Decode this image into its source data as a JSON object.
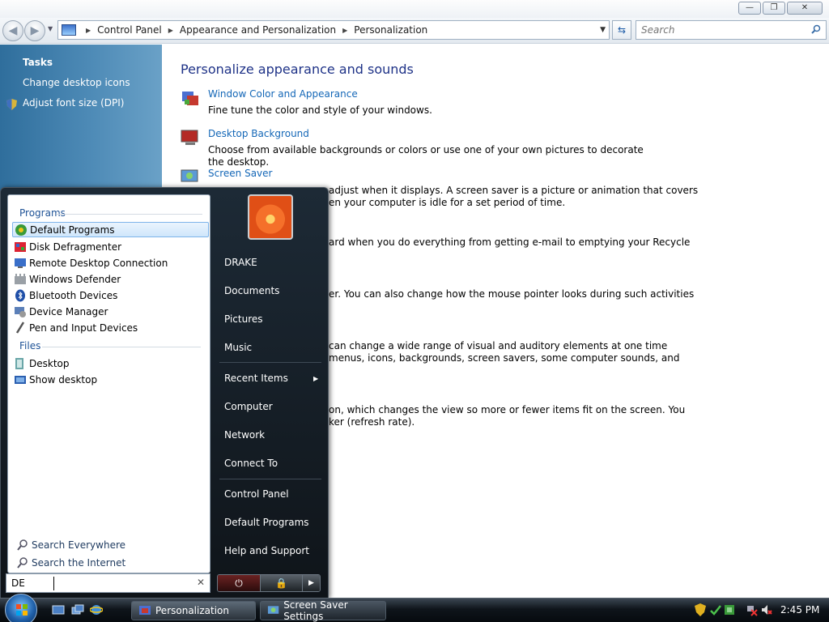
{
  "window": {
    "title_buttons": {
      "minimize": "—",
      "maximize": "❐",
      "close": "✕"
    }
  },
  "address": {
    "crumbs": [
      "Control Panel",
      "Appearance and Personalization",
      "Personalization"
    ],
    "search_placeholder": "Search"
  },
  "tasks": {
    "title": "Tasks",
    "links": [
      "Change desktop icons",
      "Adjust font size (DPI)"
    ]
  },
  "main": {
    "heading": "Personalize appearance and sounds",
    "items": [
      {
        "title": "Window Color and Appearance",
        "desc": "Fine tune the color and style of your windows."
      },
      {
        "title": "Desktop Background",
        "desc": "Choose from available backgrounds or colors or use one of your own pictures to decorate the desktop."
      },
      {
        "title": "Screen Saver",
        "desc": "adjust when it displays. A screen saver is a picture or animation that covers",
        "desc2": "en your computer is idle for a set period of time."
      }
    ],
    "fragments": [
      "ard when you do everything from getting e-mail to emptying your Recycle",
      "er. You can also change how the mouse pointer looks during such activities",
      "can change a wide range of visual and auditory elements at one time",
      "menus, icons, backgrounds, screen savers, some computer sounds, and",
      "on, which changes the view so more or fewer items fit on the screen. You",
      "ker (refresh rate)."
    ]
  },
  "start_menu": {
    "programs_label": "Programs",
    "programs": [
      "Default Programs",
      "Disk Defragmenter",
      "Remote Desktop Connection",
      "Windows Defender",
      "Bluetooth Devices",
      "Device Manager",
      "Pen and Input Devices"
    ],
    "files_label": "Files",
    "files": [
      "Desktop",
      "Show desktop"
    ],
    "search_everywhere": "Search Everywhere",
    "search_internet": "Search the Internet",
    "search_value": "DE",
    "clear": "✕",
    "right_items": [
      "DRAKE",
      "Documents",
      "Pictures",
      "Music",
      "Recent Items",
      "Computer",
      "Network",
      "Connect To",
      "Control Panel",
      "Default Programs",
      "Help and Support"
    ],
    "power_symbol": "⏻",
    "lock_symbol": "🔒",
    "arrow_symbol": "▶"
  },
  "taskbar": {
    "buttons": [
      "Personalization",
      "Screen Saver Settings"
    ],
    "clock": "2:45 PM"
  },
  "icons": {
    "back": "back-arrow-icon",
    "forward": "forward-arrow-icon",
    "search": "magnifier-icon",
    "shield": "uac-shield-icon"
  },
  "colors": {
    "link": "#1467b7",
    "heading": "#1e3287",
    "task_pane": "#3f7eac",
    "group_label": "#1e5296"
  }
}
